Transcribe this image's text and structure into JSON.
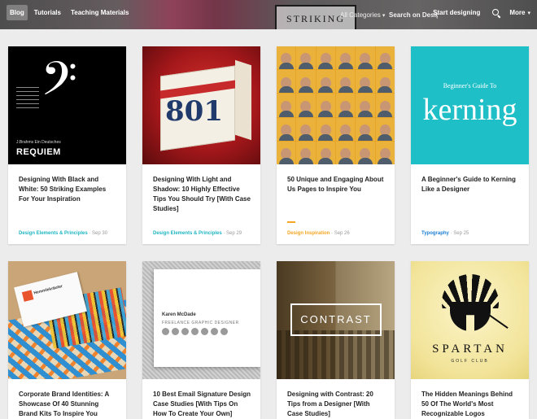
{
  "header": {
    "nav": [
      {
        "label": "Blog"
      },
      {
        "label": "Tutorials"
      },
      {
        "label": "Teaching Materials"
      }
    ],
    "hero_text": "STRIKING",
    "categories_label": "All Categories",
    "search_placeholder": "Search on Design School",
    "start_label": "Start designing",
    "more_label": "More"
  },
  "colors": {
    "category_teal": "#1fb6c1",
    "category_orange": "#f5a623",
    "category_blue": "#1b7fd1"
  },
  "cards": [
    {
      "title": "Designing With Black and White: 50 Striking Examples For Your Inspiration",
      "category": "Design Elements & Principles",
      "date": "Sep 30",
      "thumb": {
        "main": "REQUIEM",
        "sub": "J.Brahms Ein Deutsches"
      }
    },
    {
      "title": "Designing With Light and Shadow: 10 Highly Effective Tips You Should Try [With Case Studies]",
      "category": "Design Elements & Principles",
      "date": "Sep 29",
      "thumb": {
        "main": "801"
      }
    },
    {
      "title": "50 Unique and Engaging About Us Pages to Inspire You",
      "category": "Design Inspiration",
      "date": "Sep 26"
    },
    {
      "title": "A Beginner's Guide to Kerning Like a Designer",
      "category": "Typography",
      "date": "Sep 25",
      "thumb": {
        "top": "Beginner's Guide To",
        "main": "kerning"
      }
    },
    {
      "title": "Corporate Brand Identities: A Showcase Of 40 Stunning Brand Kits To Inspire You",
      "thumb": {
        "main": "Hemmlekräuter"
      }
    },
    {
      "title": "10 Best Email Signature Design Case Studies [With Tips On How To Create Your Own]",
      "thumb": {
        "name": "Karen McDade",
        "job": "FREELANCE GRAPHIC DESIGNER"
      }
    },
    {
      "title": "Designing with Contrast: 20 Tips from a Designer [With Case Studies]",
      "thumb": {
        "main": "CONTRAST"
      }
    },
    {
      "title": "The Hidden Meanings Behind 50 Of The World's Most Recognizable Logos",
      "thumb": {
        "main": "SPARTAN",
        "sub": "GOLF CLUB"
      }
    }
  ]
}
